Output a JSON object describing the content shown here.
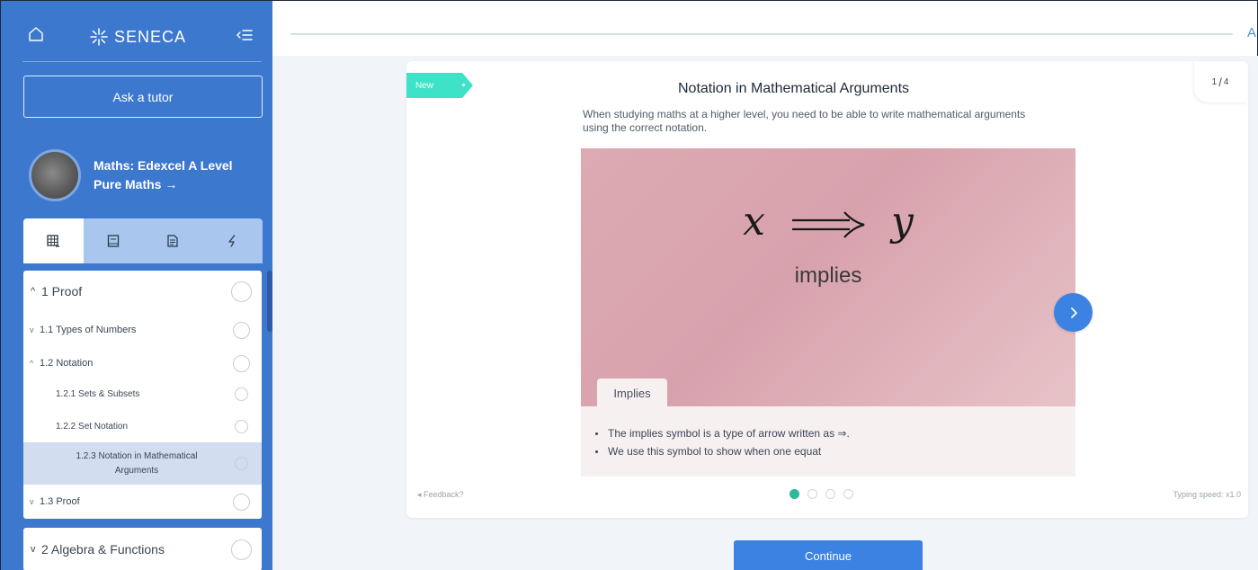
{
  "sidebar": {
    "logo_text": "SENECA",
    "ask_tutor_label": "Ask a tutor",
    "course_name": "Maths: Edexcel A Level Pure Maths →",
    "tabs": [
      {
        "icon": "grid-icon"
      },
      {
        "icon": "book-icon"
      },
      {
        "icon": "document-icon"
      },
      {
        "icon": "lightning-icon"
      }
    ],
    "toc": [
      {
        "label": "1 Proof",
        "prefix": "^"
      },
      {
        "label": "1.1 Types of Numbers",
        "prefix": "v"
      },
      {
        "label": "1.2 Notation",
        "prefix": "^"
      },
      {
        "label": "1.2.1 Sets & Subsets"
      },
      {
        "label": "1.2.2 Set Notation"
      },
      {
        "label": "1.2.3 Notation in Mathematical Arguments"
      },
      {
        "label": "1.3 Proof",
        "prefix": "v"
      }
    ],
    "toc_next": {
      "label": "2 Algebra & Functions",
      "prefix": "v"
    }
  },
  "topbar": {
    "edge_text": "A"
  },
  "card": {
    "badge": "New",
    "pager": {
      "current": "1",
      "total": "4"
    },
    "title": "Notation in Mathematical Arguments",
    "description": "When studying maths at a higher level, you need to be able to write mathematical arguments using the correct notation.",
    "formula_left": "x",
    "formula_right": "y",
    "formula_word": "implies",
    "slide_tab": "Implies",
    "bullets": [
      "The implies symbol is a type of arrow written as ⇒.",
      "We use this symbol to show when one equat"
    ],
    "feedback": "Feedback?",
    "typing_speed": "Typing speed: x1.0",
    "dots_total": 4,
    "dots_active": 1
  },
  "continue_label": "Continue",
  "colors": {
    "sidebar_bg": "#3d78cf",
    "accent": "#3b82e2",
    "badge": "#3ee3c7",
    "slide_bg": "#dcaab2",
    "active_dot": "#2fb89a"
  }
}
